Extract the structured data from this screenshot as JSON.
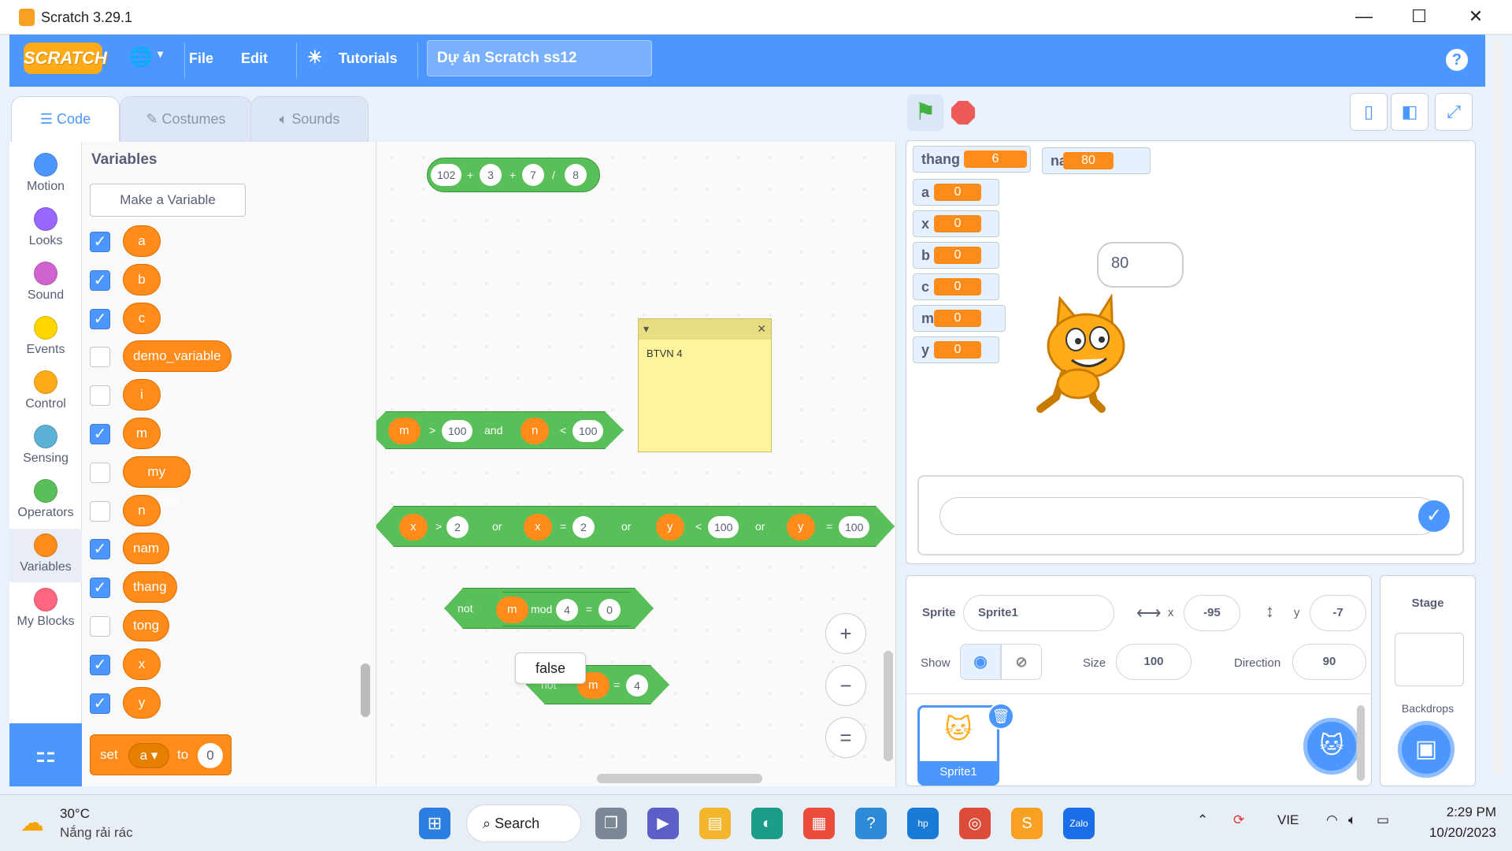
{
  "window": {
    "title": "Scratch 3.29.1",
    "minimize": "—",
    "maximize": "☐",
    "close": "✕"
  },
  "menu": {
    "logo": "SCRATCH",
    "globe": "🌐",
    "file": "File",
    "edit": "Edit",
    "tutorials": "Tutorials",
    "project_title": "Dự án Scratch ss12",
    "help": "?"
  },
  "tabs": {
    "code": "Code",
    "costumes": "Costumes",
    "sounds": "Sounds"
  },
  "categories": [
    {
      "label": "Motion",
      "color": "#4c97ff"
    },
    {
      "label": "Looks",
      "color": "#9966ff"
    },
    {
      "label": "Sound",
      "color": "#cf63cf"
    },
    {
      "label": "Events",
      "color": "#ffd500"
    },
    {
      "label": "Control",
      "color": "#ffab19"
    },
    {
      "label": "Sensing",
      "color": "#5cb1d6"
    },
    {
      "label": "Operators",
      "color": "#59c059"
    },
    {
      "label": "Variables",
      "color": "#ff8c1a"
    },
    {
      "label": "My Blocks",
      "color": "#ff6680"
    }
  ],
  "palette": {
    "title": "Variables",
    "make_variable": "Make a Variable",
    "variables": [
      {
        "name": "a",
        "checked": true
      },
      {
        "name": "b",
        "checked": true
      },
      {
        "name": "c",
        "checked": true
      },
      {
        "name": "demo_variable",
        "checked": false
      },
      {
        "name": "i",
        "checked": false
      },
      {
        "name": "m",
        "checked": true
      },
      {
        "name": "my variable",
        "checked": false
      },
      {
        "name": "n",
        "checked": false
      },
      {
        "name": "nam",
        "checked": true
      },
      {
        "name": "thang",
        "checked": true
      },
      {
        "name": "tong",
        "checked": false
      },
      {
        "name": "x",
        "checked": true
      },
      {
        "name": "y",
        "checked": true
      }
    ],
    "set_block": {
      "set": "set",
      "var": "a ▾",
      "to": "to",
      "value": "0"
    }
  },
  "workspace": {
    "expr1": {
      "a": "102",
      "op1": "+",
      "b": "3",
      "op2": "+",
      "c": "7",
      "op3": "/",
      "d": "8"
    },
    "expr2": {
      "v1": "m",
      "op1": ">",
      "n1": "100",
      "and": "and",
      "v2": "n",
      "op2": "<",
      "n2": "100"
    },
    "expr3": {
      "v1": "x",
      "op1": ">",
      "n1": "2",
      "or1": "or",
      "v2": "x",
      "op2": "=",
      "n2": "2",
      "or2": "or",
      "v3": "y",
      "op3": "<",
      "n3": "100",
      "or3": "or",
      "v4": "y",
      "op4": "=",
      "n4": "100"
    },
    "expr4": {
      "not": "not",
      "v": "m",
      "mod": "mod",
      "n1": "4",
      "eq": "=",
      "n2": "0"
    },
    "expr5": {
      "not": "not",
      "v": "m",
      "eq": "=",
      "n": "4"
    },
    "note": {
      "text": "BTVN 4",
      "collapse": "▾",
      "close": "✕"
    },
    "tooltip": "false",
    "zoom_in": "+",
    "zoom_out": "−",
    "zoom_reset": "="
  },
  "stage": {
    "monitors": [
      {
        "label": "thang",
        "value": "6"
      },
      {
        "label": "nam",
        "value": "80"
      },
      {
        "label": "a",
        "value": "0"
      },
      {
        "label": "x",
        "value": "0"
      },
      {
        "label": "b",
        "value": "0"
      },
      {
        "label": "c",
        "value": "0"
      },
      {
        "label": "m",
        "value": "0"
      },
      {
        "label": "y",
        "value": "0"
      }
    ],
    "bubble": "80",
    "ask_ok": "✓"
  },
  "sprite": {
    "sprite_label": "Sprite",
    "name": "Sprite1",
    "x_label": "x",
    "x": "-95",
    "y_label": "y",
    "y": "-7",
    "show_label": "Show",
    "size_label": "Size",
    "size": "100",
    "direction_label": "Direction",
    "direction": "90",
    "thumb_name": "Sprite1"
  },
  "stage_panel": {
    "title": "Stage",
    "backdrops": "Backdrops"
  },
  "taskbar": {
    "temp": "30°C",
    "weather": "Nắng rải rác",
    "search": "Search",
    "lang": "VIE",
    "time": "2:29 PM",
    "date": "10/20/2023"
  }
}
